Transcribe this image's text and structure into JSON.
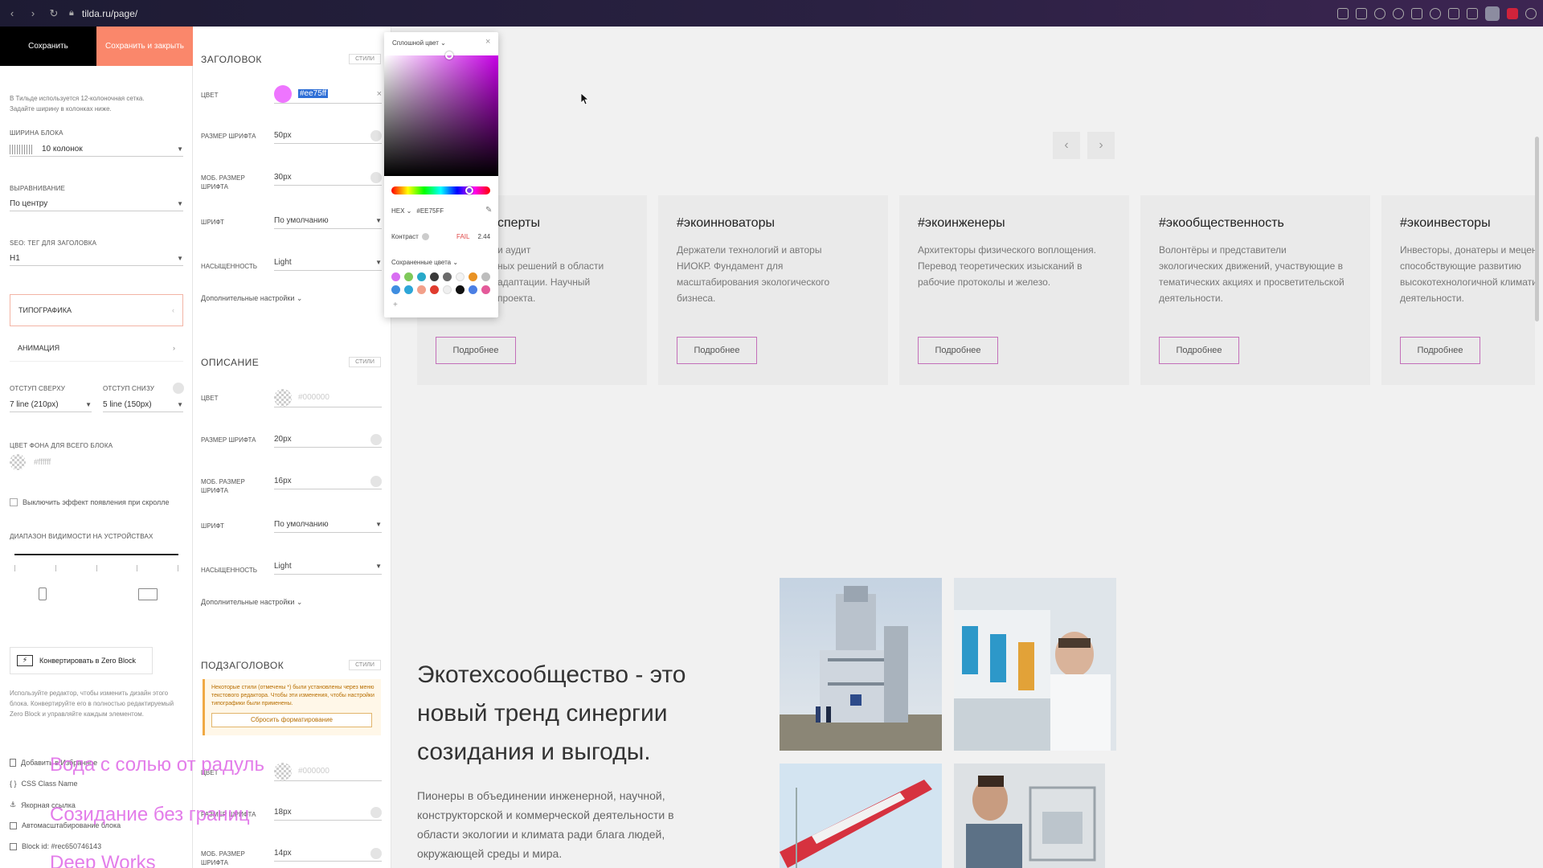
{
  "browser": {
    "url": "tilda.ru/page/"
  },
  "toolbar": {
    "save_label": "Сохранить",
    "save_close_label": "Сохранить и закрыть"
  },
  "left_panel": {
    "grid_note": "В Тильде используется 12-колоночная сетка. Задайте ширину в колонках ниже.",
    "block_width_label": "ШИРИНА БЛОКА",
    "block_width_value": "10 колонок",
    "align_label": "ВЫРАВНИВАНИЕ",
    "align_value": "По центру",
    "seo_label": "SEO: ТЕГ ДЛЯ ЗАГОЛОВКА",
    "seo_value": "H1",
    "typography_label": "ТИПОГРАФИКА",
    "animation_label": "АНИМАЦИЯ",
    "pad_top_label": "ОТСТУП СВЕРХУ",
    "pad_top_value": "7 line (210px)",
    "pad_bottom_label": "ОТСТУП СНИЗУ",
    "pad_bottom_value": "5 line (150px)",
    "bg_label": "ЦВЕТ ФОНА ДЛЯ ВСЕГО БЛОКА",
    "bg_value": "#ffffff",
    "scroll_effect_label": "Выключить эффект появления при скролле",
    "visibility_label": "ДИАПАЗОН ВИДИМОСТИ НА УСТРОЙСТВАХ",
    "convert_label": "Конвертировать в Zero Block",
    "convert_note": "Используйте редактор, чтобы изменить дизайн этого блока. Конвертируйте его в полностью редактируемый Zero Block и управляйте каждым элементом.",
    "add_bookmark": "Добавить в Избранное",
    "css_class": "CSS Class Name",
    "anchor": "Якорная ссылка",
    "autoscale": "Автомасштабирование блока",
    "block_id": "Block id: #rec650746143"
  },
  "mid_panel": {
    "heading_section": "ЗАГОЛОВОК",
    "styles_label": "СТИЛИ",
    "color_label": "ЦВЕТ",
    "color_value": "#ee75ff",
    "font_size_label": "РАЗМЕР ШРИФТА",
    "heading_font_size": "50px",
    "mob_font_size_label": "МОБ. РАЗМЕР ШРИФТА",
    "heading_mob_font_size": "30px",
    "font_label": "ШРИФТ",
    "font_value": "По умолчанию",
    "weight_label": "НАСЫЩЕННОСТЬ",
    "weight_value": "Light",
    "advanced_label": "Дополнительные настройки",
    "desc_section": "ОПИСАНИЕ",
    "desc_color": "#000000",
    "desc_font_size": "20px",
    "desc_mob_font_size": "16px",
    "sub_section": "ПОДЗАГОЛОВОК",
    "warning_text": "Некоторые стили (отмечены *) были установлены через меню текстового редактора. Чтобы эти изменения, чтобы настройки типографики были применены.",
    "reset_label": "Сбросить форматирование",
    "sub_color": "#000000",
    "sub_font_size": "18px",
    "sub_mob_font_size": "14px"
  },
  "picker": {
    "mode_label": "Сплошной цвет",
    "hex_label": "HEX",
    "hex_value": "#EE75FF",
    "contrast_label": "Контраст",
    "contrast_result": "FAIL",
    "contrast_value": "2.44",
    "saved_label": "Сохраненные цвета",
    "hue_colour": "#ee75ff",
    "swatches": [
      "#d86ef2",
      "#7fc95a",
      "#28a9c9",
      "#3a3a3a",
      "#6b6b6b",
      "#f3f3f3",
      "#e99223",
      "#bdbdbd",
      "#3f8de0",
      "#2da6d8",
      "#f2a08a",
      "#e03b2e",
      "#efefef",
      "#111111",
      "#4b7fe4",
      "#e45a9a"
    ]
  },
  "cards": [
    {
      "title": "#экоэксперты",
      "desc": "Экспертиза и аудит технологичных решений в области климатической адаптации. Научный фундамент для проекта.",
      "button": "Подробнее"
    },
    {
      "title": "#экоинноваторы",
      "desc": "Держатели технологий и авторы НИОКР. Фундамент для масштабирования экологического бизнеса.",
      "button": "Подробнее"
    },
    {
      "title": "#экоинженеры",
      "desc": "Архитекторы физического воплощения. Перевод теоретических изысканий в рабочие протоколы и железо.",
      "button": "Подробнее"
    },
    {
      "title": "#экообщественность",
      "desc": "Волонтёры и представители экологических движений, участвующие в тематических акциях и просветительской деятельности.",
      "button": "Подробнее"
    },
    {
      "title": "#экоинвесторы",
      "desc": "Инвесторы, донатеры и меценаты, способствующие развитию высокотехнологичной климатической деятельности.",
      "button": "Подробнее"
    }
  ],
  "visible_card_text": {
    "title0": "сперты",
    "desc0_l1": "и аудит",
    "desc0_l2": "ных решений в области",
    "desc0_l3": "адаптации. Научный",
    "desc0_l4": "проекта."
  },
  "content": {
    "heading": "Экотехсообщество - это новый тренд синергии созидания и выгоды.",
    "body": "Пионеры в объединении инженерной, научной, конструкторской и коммерческой деятельности в области экологии и климата ради блага людей, окружающей среды и мира."
  },
  "overlay": {
    "line1": "Вода с солью от радуль",
    "line2": "Созидание без границ",
    "line3": "Deep Works"
  }
}
